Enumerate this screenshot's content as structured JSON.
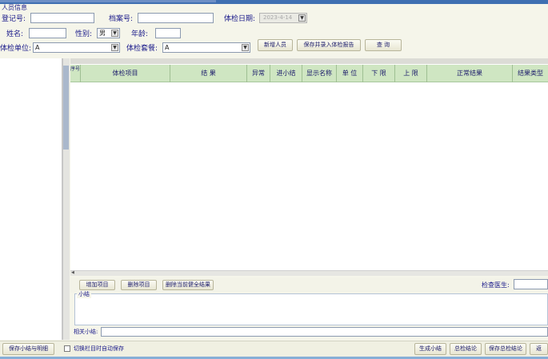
{
  "form": {
    "group_title": "人员信息",
    "reg_no_label": "登记号:",
    "file_no_label": "档案号:",
    "exam_date_label": "体检日期:",
    "exam_date_value": "2023-4-14",
    "name_label": "姓名:",
    "gender_label": "性别:",
    "gender_value": "男",
    "age_label": "年龄:",
    "exam_unit_label": "体检单位:",
    "exam_unit_value": "A",
    "exam_package_label": "体检套餐:",
    "exam_package_value": "A"
  },
  "actions": {
    "add_person": "新增人员",
    "save_enter_report": "保存并录入体检报告",
    "query": "查 询"
  },
  "grid": {
    "columns": [
      "序号",
      "体检项目",
      "结 果",
      "异常",
      "进小结",
      "显示名称",
      "单 位",
      "下 限",
      "上 限",
      "正常结果",
      "结果类型"
    ]
  },
  "grid_buttons": {
    "add_item": "增加项目",
    "delete_item": "删除项目",
    "delete_all_results": "删除当前健全结果"
  },
  "exam_doctor_label": "检查医生:",
  "summary": {
    "legend": "小结",
    "related_label": "相关小结:"
  },
  "bottom": {
    "save_summary_detail": "保存小结与明细",
    "auto_save_label": "切换栏目时自动保存",
    "generate_summary": "生成小结",
    "overall_conclusion": "总检结论",
    "save_overall_conclusion": "保存总检结论",
    "next": "返"
  }
}
